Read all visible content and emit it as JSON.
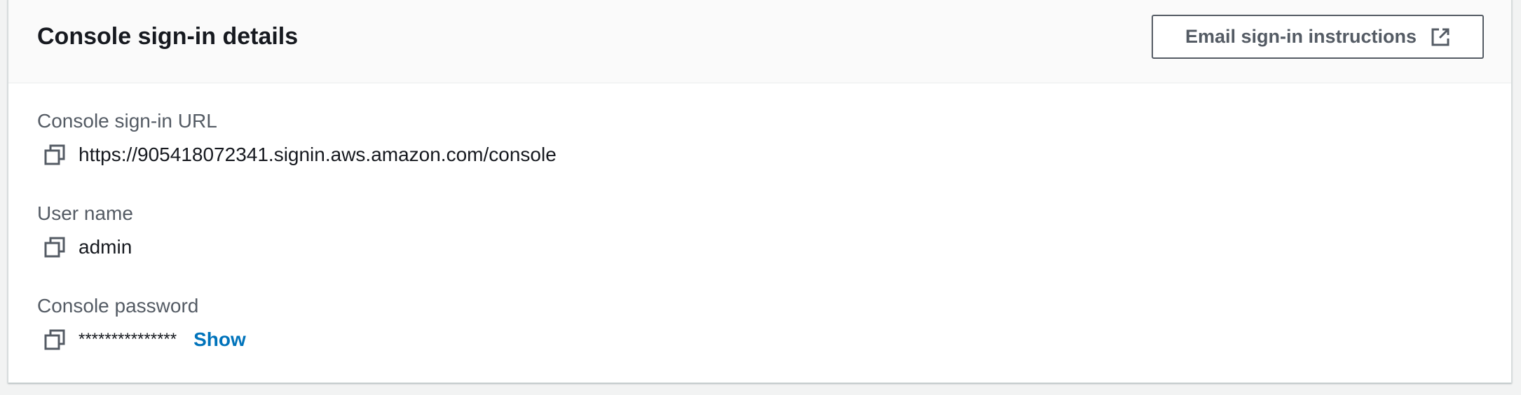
{
  "panel": {
    "title": "Console sign-in details",
    "email_button_label": "Email sign-in instructions",
    "email_button_icon": "external-link-icon"
  },
  "fields": [
    {
      "label": "Console sign-in URL",
      "value": "https://905418072341.signin.aws.amazon.com/console",
      "icon": "copy-icon"
    },
    {
      "label": "User name",
      "value": "admin",
      "icon": "copy-icon"
    },
    {
      "label": "Console password",
      "value": "***************",
      "icon": "copy-icon",
      "show_label": "Show"
    }
  ],
  "colors": {
    "link": "#0073bb",
    "label": "#545b64",
    "text": "#16191f",
    "header_bg": "#fafafa"
  }
}
